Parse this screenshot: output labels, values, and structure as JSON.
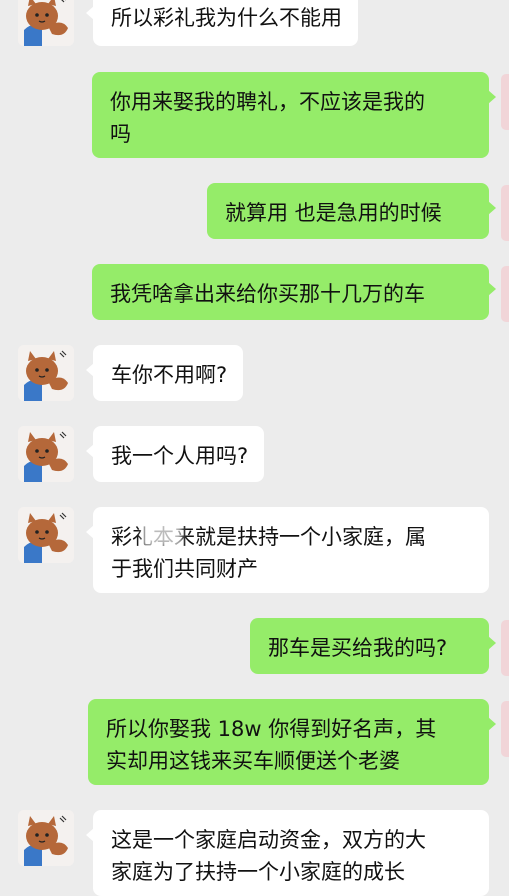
{
  "messages": [
    {
      "side": "in",
      "lines": [
        "所以彩礼我为什么不能用"
      ]
    },
    {
      "side": "out",
      "lines": [
        "你用来娶我的聘礼，不应该是我的",
        "吗"
      ]
    },
    {
      "side": "out",
      "lines": [
        "就算用 也是急用的时候"
      ]
    },
    {
      "side": "out",
      "lines": [
        "我凭啥拿出来给你买那十几万的车"
      ]
    },
    {
      "side": "in",
      "lines": [
        "车你不用啊?"
      ]
    },
    {
      "side": "in",
      "lines": [
        "我一个人用吗?"
      ]
    },
    {
      "side": "in",
      "lines": [
        "彩礼本来就是扶持一个小家庭，属",
        "于我们共同财产"
      ]
    },
    {
      "side": "out",
      "lines": [
        "那车是买给我的吗?"
      ]
    },
    {
      "side": "out",
      "lines": [
        "所以你娶我 18w 你得到好名声，其",
        "实却用这钱来买车顺便送个老婆"
      ]
    },
    {
      "side": "in",
      "lines": [
        "这是一个家庭启动资金，双方的大",
        "家庭为了扶持一个小家庭的成长"
      ]
    }
  ],
  "colors": {
    "background": "#ececec",
    "incoming": "#ffffff",
    "outgoing": "#95ec69"
  },
  "icons": {
    "contact_avatar": "cartoon-cat-icon"
  }
}
